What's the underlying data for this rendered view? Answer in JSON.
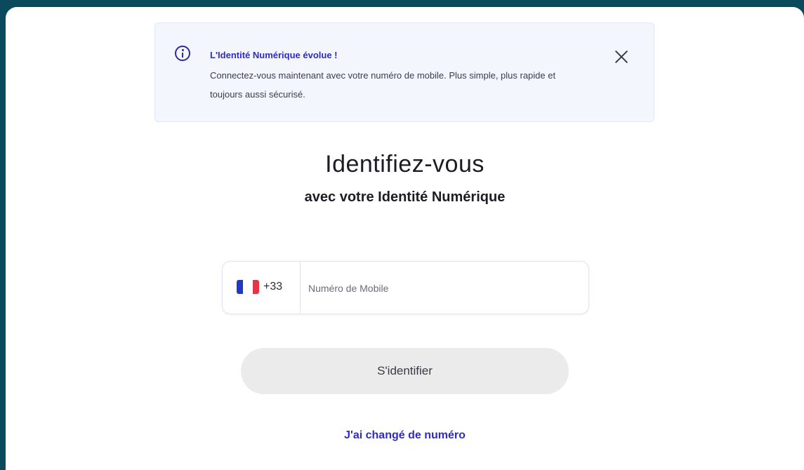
{
  "notice": {
    "icon": "info-circle-icon",
    "title": "L'Identité Numérique évolue !",
    "body": "Connectez-vous maintenant avec votre numéro de mobile. Plus simple, plus rapide et toujours aussi sécurisé.",
    "close_icon": "close-icon",
    "accent_color": "#2f2bc2",
    "background_color": "#f4f6fe"
  },
  "header": {
    "title": "Identifiez-vous",
    "subtitle": "avec votre Identité Numérique"
  },
  "phone_form": {
    "country_flag": "france-flag-icon",
    "dial_code": "+33",
    "input_value": "",
    "input_placeholder": "Numéro de Mobile"
  },
  "submit_button": {
    "label": "S'identifier",
    "background_color": "#ebebeb"
  },
  "changed_number_link": {
    "label": "J'ai changé de numéro"
  },
  "colors": {
    "page_background": "#0b4a5c",
    "card_background": "#ffffff",
    "link_color": "#2f2bc2"
  }
}
